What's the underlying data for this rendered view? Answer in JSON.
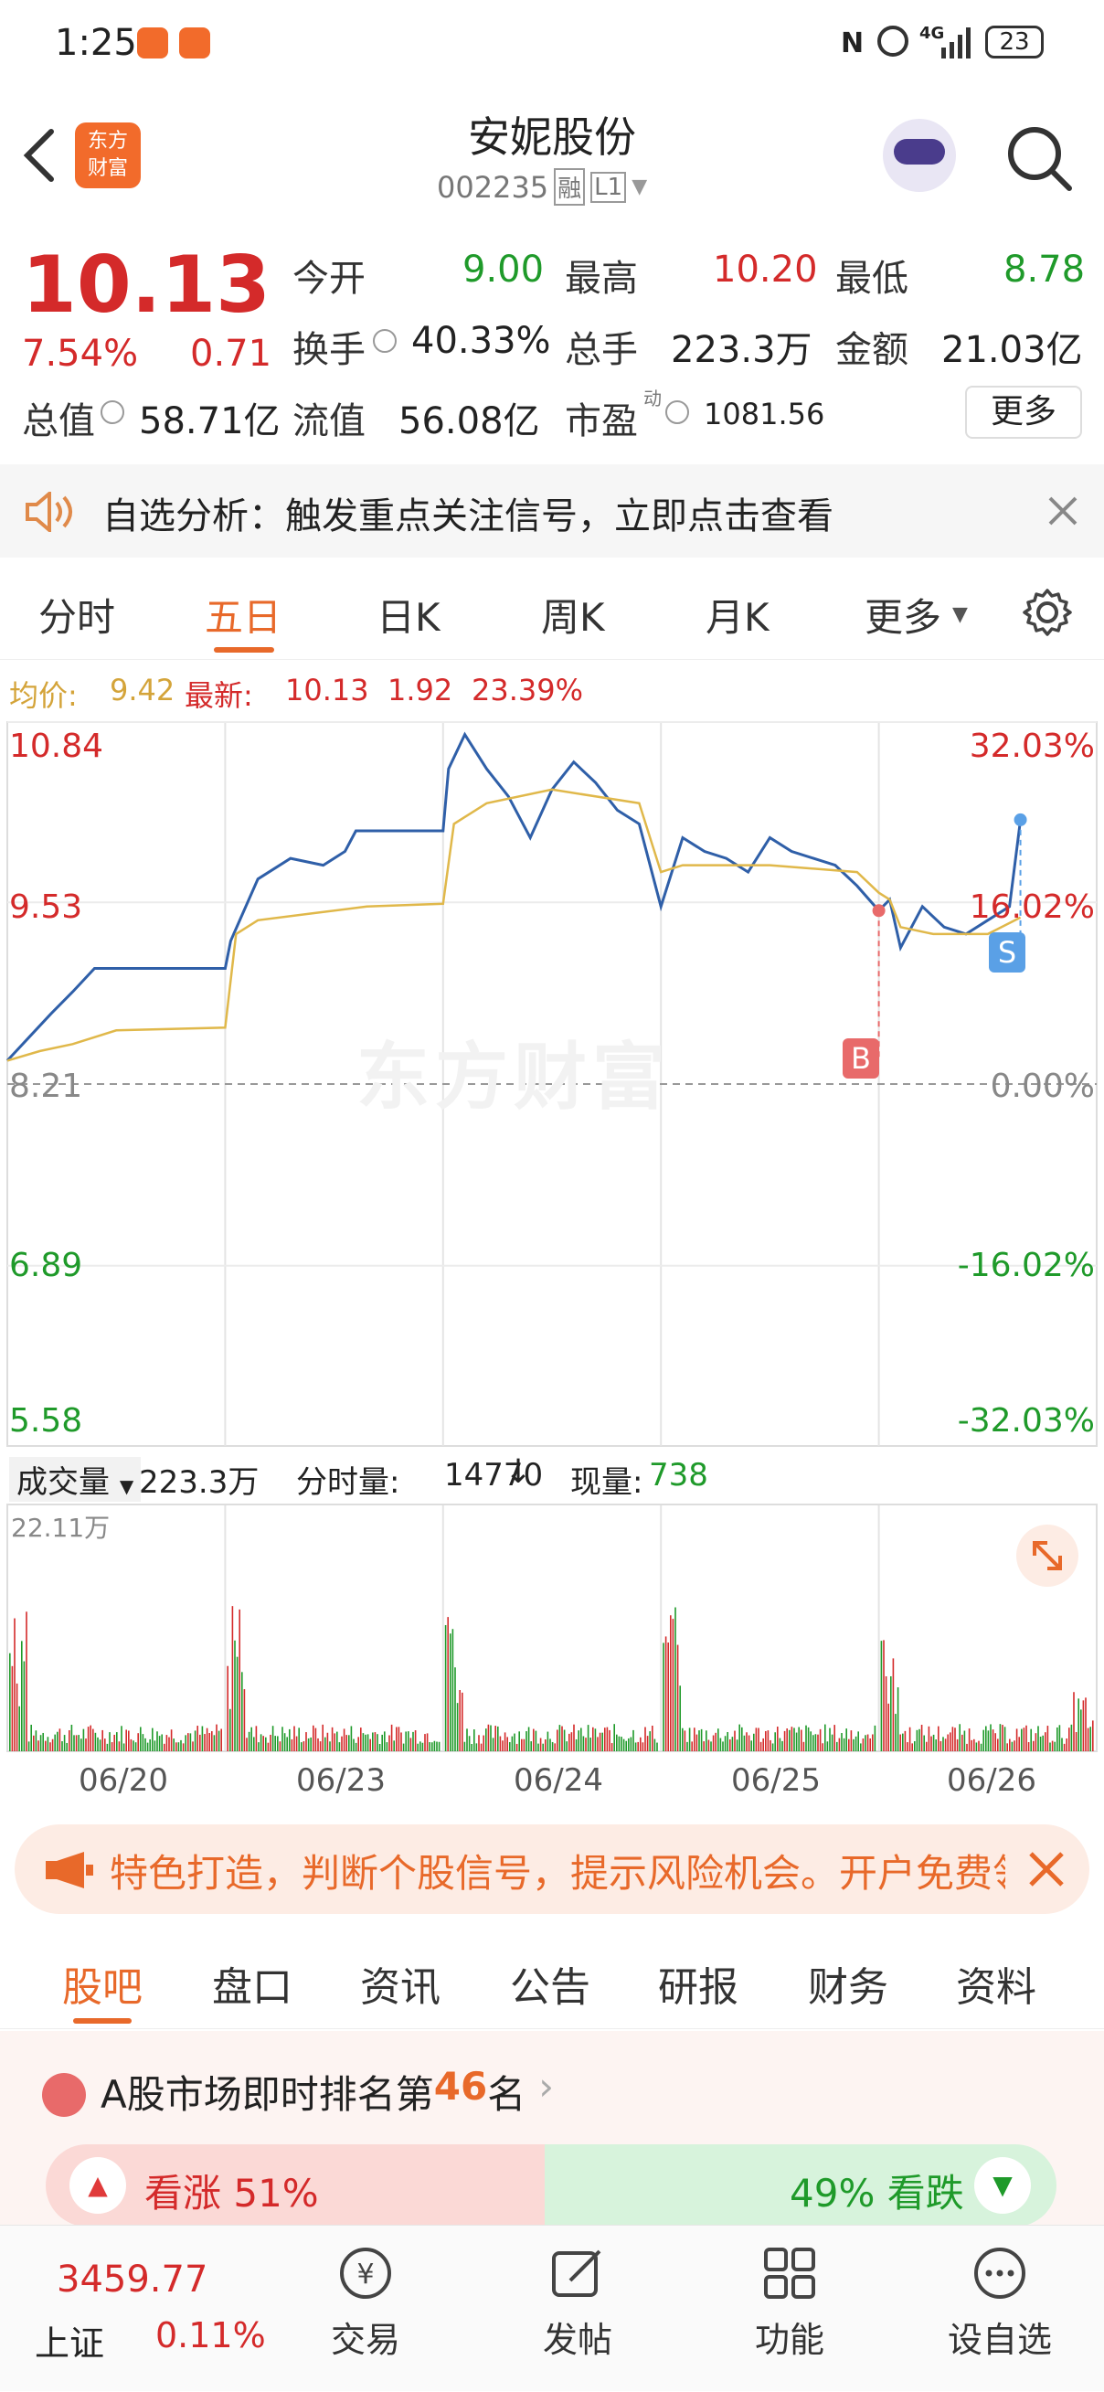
{
  "status_bar": {
    "time": "1:25",
    "network": "4G",
    "battery": "23"
  },
  "header": {
    "title": "安妮股份",
    "code": "002235",
    "tag_rong": "融",
    "tag_level": "L1",
    "logo_text_1": "东方",
    "logo_text_2": "财富"
  },
  "quote": {
    "price": "10.13",
    "change_pct": "7.54%",
    "change": "0.71",
    "open_label": "今开",
    "open": "9.00",
    "high_label": "最高",
    "high": "10.20",
    "low_label": "最低",
    "low": "8.78",
    "turnover_label": "换手",
    "turnover": "40.33%",
    "volume_label": "总手",
    "volume": "223.3万",
    "amount_label": "金额",
    "amount": "21.03亿",
    "mktcap_label": "总值",
    "mktcap": "58.71亿",
    "float_label": "流值",
    "float": "56.08亿",
    "pe_label": "市盈",
    "pe_sup": "动",
    "pe": "1081.56",
    "more_button": "更多"
  },
  "notice": {
    "text": "自选分析：触发重点关注信号，立即点击查看"
  },
  "chart_tabs": [
    "分时",
    "五日",
    "日K",
    "周K",
    "月K",
    "更多"
  ],
  "active_tab": "五日",
  "avg_line": {
    "avg_label": "均价:",
    "avg": "9.42",
    "latest_label": "最新:",
    "latest": "10.13",
    "change": "1.92",
    "pct": "23.39%"
  },
  "chart_labels": {
    "y_left": [
      "10.84",
      "9.53",
      "8.21",
      "6.89",
      "5.58"
    ],
    "y_right": [
      "32.03%",
      "16.02%",
      "0.00%",
      "-16.02%",
      "-32.03%"
    ],
    "watermark": "东方财富",
    "marker_b": "B",
    "marker_s": "S"
  },
  "chart_data": {
    "type": "line",
    "title": "",
    "x_dates": [
      "06/20",
      "06/23",
      "06/24",
      "06/25",
      "06/26"
    ],
    "ylim": [
      5.58,
      10.84
    ],
    "prev_close": 8.21,
    "series": [
      {
        "name": "",
        "color": "#2f5fa8",
        "points": [
          [
            0.0,
            8.38
          ],
          [
            0.02,
            8.55
          ],
          [
            0.04,
            8.72
          ],
          [
            0.06,
            8.88
          ],
          [
            0.08,
            9.05
          ],
          [
            0.1,
            9.05
          ],
          [
            0.15,
            9.05
          ],
          [
            0.2,
            9.05
          ],
          [
            0.205,
            9.25
          ],
          [
            0.23,
            9.7
          ],
          [
            0.26,
            9.85
          ],
          [
            0.29,
            9.8
          ],
          [
            0.31,
            9.9
          ],
          [
            0.32,
            10.05
          ],
          [
            0.36,
            10.05
          ],
          [
            0.4,
            10.05
          ],
          [
            0.405,
            10.5
          ],
          [
            0.42,
            10.75
          ],
          [
            0.44,
            10.5
          ],
          [
            0.46,
            10.3
          ],
          [
            0.48,
            10.0
          ],
          [
            0.5,
            10.35
          ],
          [
            0.52,
            10.55
          ],
          [
            0.54,
            10.4
          ],
          [
            0.56,
            10.2
          ],
          [
            0.58,
            10.1
          ],
          [
            0.6,
            9.5
          ],
          [
            0.62,
            10.0
          ],
          [
            0.64,
            9.9
          ],
          [
            0.66,
            9.85
          ],
          [
            0.68,
            9.75
          ],
          [
            0.7,
            10.0
          ],
          [
            0.72,
            9.9
          ],
          [
            0.74,
            9.85
          ],
          [
            0.76,
            9.8
          ],
          [
            0.78,
            9.65
          ],
          [
            0.8,
            9.47
          ],
          [
            0.81,
            9.55
          ],
          [
            0.82,
            9.2
          ],
          [
            0.84,
            9.5
          ],
          [
            0.86,
            9.35
          ],
          [
            0.88,
            9.3
          ],
          [
            0.9,
            9.4
          ],
          [
            0.92,
            9.5
          ],
          [
            0.93,
            10.13
          ]
        ]
      },
      {
        "name": "",
        "color": "#e0b84a",
        "points": [
          [
            0.0,
            8.38
          ],
          [
            0.03,
            8.45
          ],
          [
            0.06,
            8.5
          ],
          [
            0.1,
            8.6
          ],
          [
            0.2,
            8.62
          ],
          [
            0.21,
            9.3
          ],
          [
            0.23,
            9.4
          ],
          [
            0.28,
            9.45
          ],
          [
            0.33,
            9.5
          ],
          [
            0.4,
            9.52
          ],
          [
            0.41,
            10.1
          ],
          [
            0.44,
            10.25
          ],
          [
            0.5,
            10.35
          ],
          [
            0.58,
            10.25
          ],
          [
            0.6,
            9.75
          ],
          [
            0.62,
            9.8
          ],
          [
            0.7,
            9.8
          ],
          [
            0.78,
            9.75
          ],
          [
            0.8,
            9.6
          ],
          [
            0.81,
            9.55
          ],
          [
            0.82,
            9.35
          ],
          [
            0.85,
            9.3
          ],
          [
            0.9,
            9.3
          ],
          [
            0.93,
            9.42
          ]
        ]
      }
    ]
  },
  "volume_bar": {
    "label": "成交量",
    "total": "223.3万",
    "tick_label": "分时量:",
    "tick": "14770",
    "now_label": "现量:",
    "now": "738",
    "ymax": "22.11万"
  },
  "ad": {
    "text": "特色打造，判断个股信号，提示风险机会。开户免费领"
  },
  "sub_tabs": [
    "股吧",
    "盘口",
    "资讯",
    "公告",
    "研报",
    "财务",
    "资料"
  ],
  "active_sub_tab": "股吧",
  "rank": {
    "prefix": "A股市场即时排名第",
    "num": "46",
    "suffix": "名",
    "up": "看涨 51%",
    "down": "49% 看跌"
  },
  "bottom_nav": {
    "index_value": "3459.77",
    "index_name": "上证",
    "index_change": "0.11%",
    "items": [
      "交易",
      "发帖",
      "功能",
      "设自选"
    ]
  }
}
